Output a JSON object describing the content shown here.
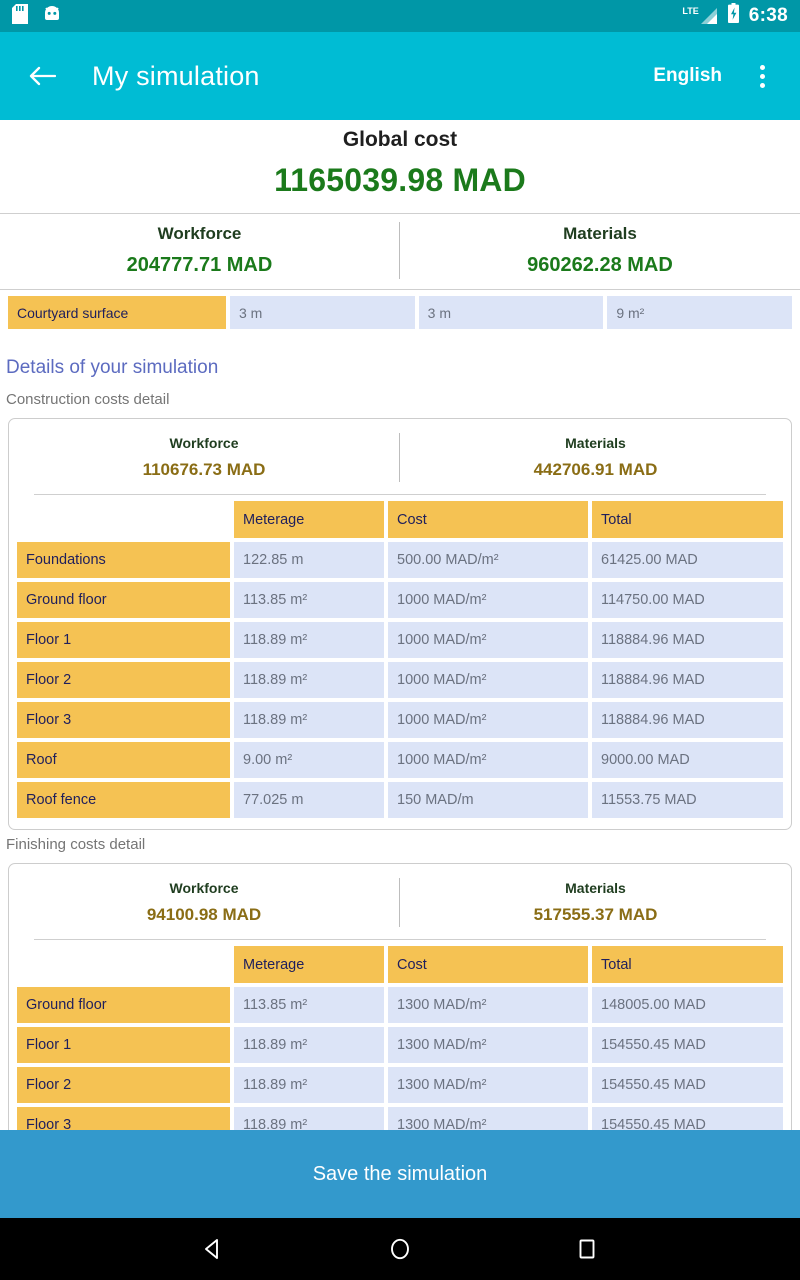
{
  "status_bar": {
    "icons": [
      "sd-card-icon",
      "android-head-icon"
    ],
    "network": "LTE",
    "battery": "charging",
    "clock": "6:38"
  },
  "app_bar": {
    "back_icon": "arrow-back-icon",
    "title": "My simulation",
    "language": "English",
    "overflow_icon": "more-vertical-icon"
  },
  "global": {
    "title": "Global cost",
    "amount": "1165039.98 MAD",
    "workforce_label": "Workforce",
    "workforce_value": "204777.71 MAD",
    "materials_label": "Materials",
    "materials_value": "960262.28 MAD"
  },
  "courtyard": {
    "label": "Courtyard surface",
    "width": "3 m",
    "length": "3 m",
    "surface": "9 m²"
  },
  "details": {
    "heading": "Details of your simulation"
  },
  "construction": {
    "sub_heading": "Construction costs detail",
    "workforce_label": "Workforce",
    "workforce_value": "110676.73 MAD",
    "materials_label": "Materials",
    "materials_value": "442706.91 MAD",
    "columns": [
      "",
      "Meterage",
      "Cost",
      "Total"
    ],
    "rows": [
      {
        "label": "Foundations",
        "meterage": "122.85 m",
        "cost": "500.00 MAD/m²",
        "total": "61425.00 MAD"
      },
      {
        "label": "Ground floor",
        "meterage": "113.85 m²",
        "cost": "1000 MAD/m²",
        "total": "114750.00 MAD"
      },
      {
        "label": "Floor 1",
        "meterage": "118.89 m²",
        "cost": "1000 MAD/m²",
        "total": "118884.96 MAD"
      },
      {
        "label": "Floor 2",
        "meterage": "118.89 m²",
        "cost": "1000 MAD/m²",
        "total": "118884.96 MAD"
      },
      {
        "label": "Floor 3",
        "meterage": "118.89 m²",
        "cost": "1000 MAD/m²",
        "total": "118884.96 MAD"
      },
      {
        "label": "Roof",
        "meterage": "9.00 m²",
        "cost": "1000 MAD/m²",
        "total": "9000.00 MAD"
      },
      {
        "label": "Roof fence",
        "meterage": "77.025 m",
        "cost": "150 MAD/m",
        "total": "11553.75 MAD"
      }
    ]
  },
  "finishing": {
    "sub_heading": "Finishing costs detail",
    "workforce_label": "Workforce",
    "workforce_value": "94100.98 MAD",
    "materials_label": "Materials",
    "materials_value": "517555.37 MAD",
    "columns": [
      "",
      "Meterage",
      "Cost",
      "Total"
    ],
    "rows": [
      {
        "label": "Ground floor",
        "meterage": "113.85 m²",
        "cost": "1300 MAD/m²",
        "total": "148005.00 MAD"
      },
      {
        "label": "Floor 1",
        "meterage": "118.89 m²",
        "cost": "1300 MAD/m²",
        "total": "154550.45 MAD"
      },
      {
        "label": "Floor 2",
        "meterage": "118.89 m²",
        "cost": "1300 MAD/m²",
        "total": "154550.45 MAD"
      },
      {
        "label": "Floor 3",
        "meterage": "118.89 m²",
        "cost": "1300 MAD/m²",
        "total": "154550.45 MAD"
      }
    ]
  },
  "save_button": {
    "label": "Save the simulation"
  },
  "nav_bar": {
    "back": "nav-back-icon",
    "home": "nav-home-icon",
    "recents": "nav-recents-icon"
  },
  "colors": {
    "status_bar": "#0097A7",
    "app_bar": "#00BCD4",
    "accent_green": "#1B7A1B",
    "accent_gold": "#8A6D15",
    "row_label": "#F5C253",
    "row_cell": "#DCE4F7",
    "details_heading": "#5C6BC0",
    "save_button": "#3399CC"
  }
}
